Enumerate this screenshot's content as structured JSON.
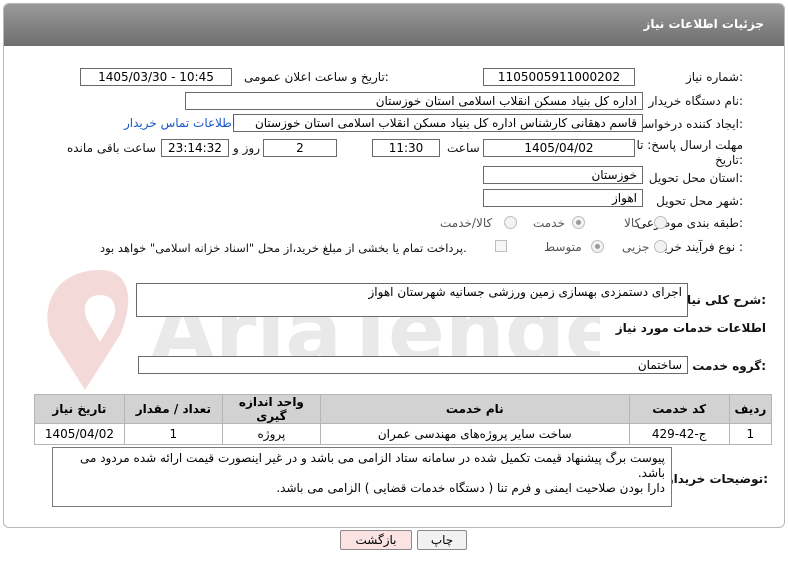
{
  "header": {
    "title": "جزئیات اطلاعات نیاز"
  },
  "fields": {
    "need_number_label": "شماره نیاز:",
    "need_number": "1105005911000202",
    "announce_label": "تاریخ و ساعت اعلان عمومی:",
    "announce_value": "1405/03/30 - 10:45",
    "buyer_org_label": "نام دستگاه خریدار:",
    "buyer_org": "اداره کل بنیاد مسکن انقلاب اسلامی استان خوزستان",
    "creator_label": "ایجاد کننده درخواست:",
    "creator": "قاسم دهقانی کارشناس اداره کل بنیاد مسکن انقلاب اسلامی استان خوزستان",
    "contact_link": "اطلاعات تماس خریدار",
    "deadline_label": "مهلت ارسال پاسخ: تا",
    "deadline_label2": "تاریخ:",
    "deadline_date": "1405/04/02",
    "time_label": "ساعت",
    "deadline_time": "11:30",
    "days_count": "2",
    "days_label": "روز و",
    "remaining_time": "23:14:32",
    "remaining_label": "ساعت باقی مانده",
    "province_label": "استان محل تحویل:",
    "province": "خوزستان",
    "city_label": "شهر محل تحویل:",
    "city": "اهواز",
    "category_label": "طبقه بندی موضوعی:",
    "cat_goods": "کالا",
    "cat_service": "خدمت",
    "cat_goods_service": "کالا/خدمت",
    "purchase_type_label": "نوع فرآیند خرید :",
    "pt_partial": "جزیی",
    "pt_medium": "متوسط",
    "payment_note": "پرداخت تمام یا بخشی از مبلغ خرید،از محل \"اسناد خزانه اسلامی\" خواهد بود."
  },
  "summary": {
    "label": "شرح کلی نیاز:",
    "value": "اجرای دستمزدی  بهسازی  زمین ورزشی جسانیه   شهرستان  اهواز"
  },
  "services_title": "اطلاعات خدمات مورد نیاز",
  "service_group": {
    "label": "گروه خدمت:",
    "value": "ساختمان"
  },
  "table": {
    "headers": [
      "ردیف",
      "کد خدمت",
      "نام خدمت",
      "واحد اندازه گیری",
      "تعداد / مقدار",
      "تاریخ نیاز"
    ],
    "rows": [
      [
        "1",
        "ج-42-429",
        "ساخت سایر پروژه‌های مهندسی عمران",
        "پروژه",
        "1",
        "1405/04/02"
      ]
    ]
  },
  "notes": {
    "label": "توضیحات خریدار:",
    "line1": "پیوست برگ پیشنهاد قیمت تکمیل شده در سامانه ستاد الزامی می باشد و در غیر اینصورت  قیمت ارائه شده مردود می باشد.",
    "line2": "دارا بودن صلاحیت ایمنی و فرم تنا ( دستگاه خدمات قضایی ) الزامی می باشد."
  },
  "buttons": {
    "print": "چاپ",
    "back": "بازگشت"
  },
  "colors": {
    "header": "#7d7d7d",
    "link": "#1a57c9",
    "back_button": "#fbe3e3"
  }
}
